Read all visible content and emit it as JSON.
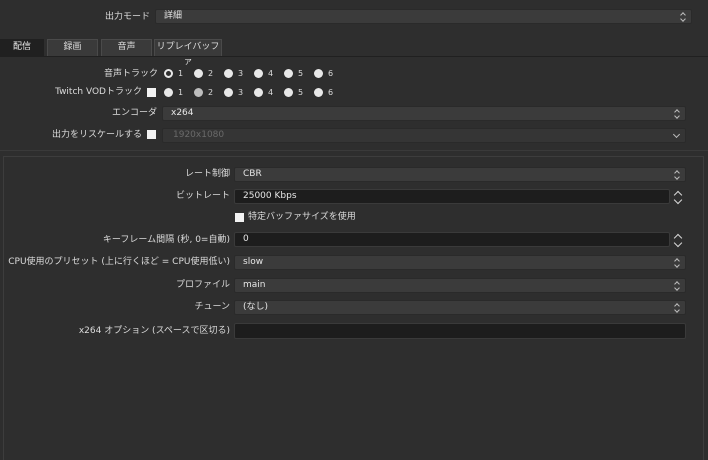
{
  "output_mode": {
    "label": "出力モード",
    "value": "詳細"
  },
  "tabs": [
    {
      "label": "配信"
    },
    {
      "label": "録画"
    },
    {
      "label": "音声"
    },
    {
      "label": "リプレイバッファ"
    }
  ],
  "audio_track": {
    "label": "音声トラック",
    "options": [
      "1",
      "2",
      "3",
      "4",
      "5",
      "6"
    ],
    "selected": "1"
  },
  "twitch_vod": {
    "label": "Twitch VODトラック",
    "options": [
      "1",
      "2",
      "3",
      "4",
      "5",
      "6"
    ],
    "selected": "2"
  },
  "encoder": {
    "label": "エンコーダ",
    "value": "x264"
  },
  "rescale": {
    "label": "出力をリスケールする",
    "value": "1920x1080"
  },
  "settings": {
    "rate_control": {
      "label": "レート制御",
      "value": "CBR"
    },
    "bitrate": {
      "label": "ビットレート",
      "value": "25000 Kbps"
    },
    "custom_buffer": {
      "label": "特定バッファサイズを使用"
    },
    "keyframe": {
      "label": "キーフレーム間隔 (秒, 0=自動)",
      "value": "0"
    },
    "cpu_preset": {
      "label": "CPU使用のプリセット (上に行くほど = CPU使用低い)",
      "value": "slow"
    },
    "profile": {
      "label": "プロファイル",
      "value": "main"
    },
    "tune": {
      "label": "チューン",
      "value": "(なし)"
    },
    "x264_options": {
      "label": "x264 オプション (スペースで区切る)",
      "value": ""
    }
  }
}
